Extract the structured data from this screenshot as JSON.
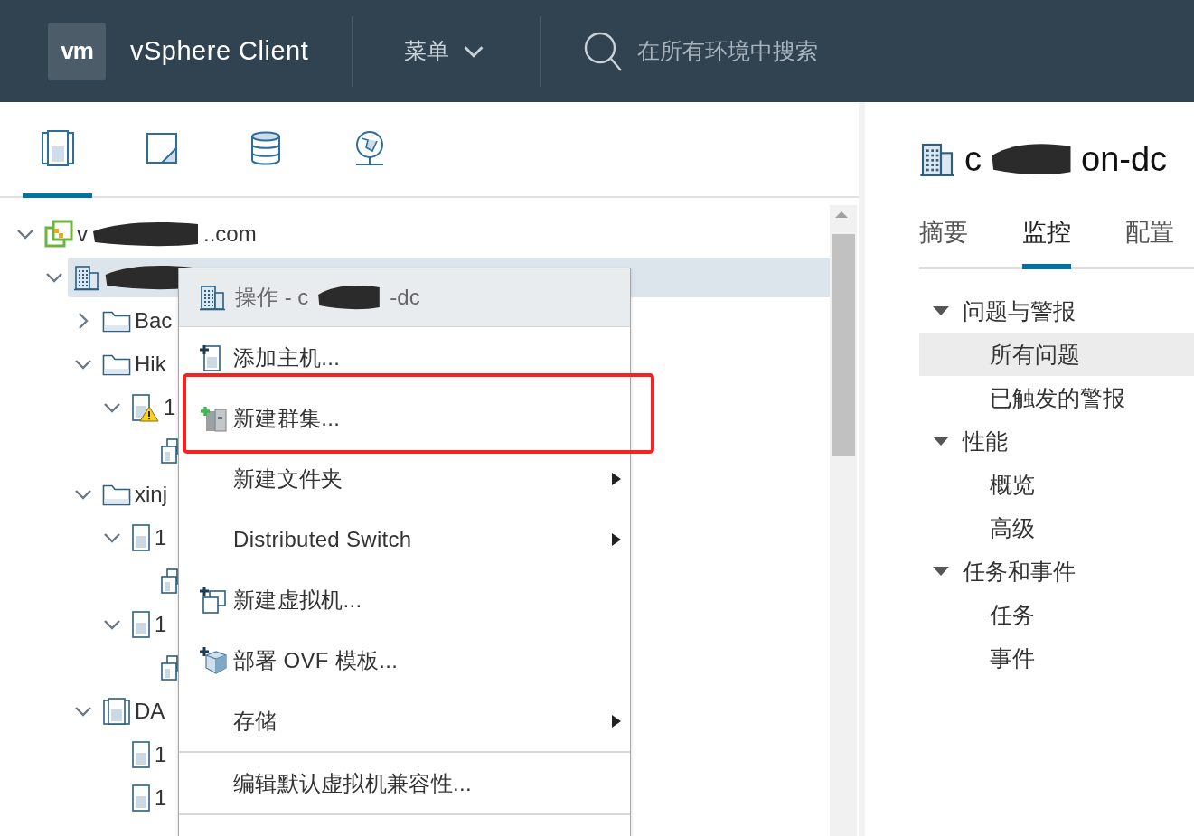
{
  "header": {
    "logo": "vm",
    "title": "vSphere Client",
    "menu": "菜单",
    "search": {
      "placeholder": "在所有环境中搜索"
    }
  },
  "view_tabs": [
    {
      "kind": "hosts",
      "selected": true
    },
    {
      "kind": "vms",
      "selected": false
    },
    {
      "kind": "storage",
      "selected": false
    },
    {
      "kind": "network",
      "selected": false
    }
  ],
  "tree": [
    {
      "kind": "vcenter",
      "label_start": "v",
      "label_end": "..com",
      "expanded": true,
      "selected": false,
      "children": [
        {
          "kind": "datacenter",
          "expanded": true,
          "selected": true,
          "children": [
            {
              "kind": "folder",
              "label": "Bac",
              "expanded": false,
              "selected": false
            },
            {
              "kind": "folder",
              "label": "Hik",
              "expanded": true,
              "selected": false,
              "children": [
                {
                  "kind": "host",
                  "label": "1",
                  "warning": true,
                  "expanded": true,
                  "selected": false,
                  "children": [
                    {
                      "kind": "vm",
                      "selected": false
                    }
                  ]
                }
              ]
            },
            {
              "kind": "folder",
              "label": "xinj",
              "expanded": true,
              "selected": false,
              "children": [
                {
                  "kind": "host",
                  "label": "1",
                  "warning": false,
                  "expanded": true,
                  "selected": false,
                  "children": [
                    {
                      "kind": "vm",
                      "selected": false
                    }
                  ]
                },
                {
                  "kind": "host",
                  "label": "1",
                  "warning": false,
                  "expanded": true,
                  "selected": false,
                  "children": [
                    {
                      "kind": "vm",
                      "selected": false
                    }
                  ]
                }
              ]
            },
            {
              "kind": "cluster",
              "label": "DA",
              "expanded": true,
              "selected": false,
              "children": [
                {
                  "kind": "host",
                  "label": "1",
                  "warning": false,
                  "selected": false
                },
                {
                  "kind": "host",
                  "label": "1",
                  "warning": false,
                  "selected": false
                }
              ]
            }
          ]
        }
      ]
    }
  ],
  "context_menu": {
    "title_start": "操作 - c",
    "title_end": "-dc",
    "items": [
      {
        "kind": "host",
        "label": "添加主机...",
        "submenu": false,
        "highlighted": false
      },
      {
        "kind": "cluster",
        "label": "新建群集...",
        "submenu": false,
        "highlighted": true
      },
      {
        "kind": "plain",
        "label": "新建文件夹",
        "submenu": true,
        "highlighted": false
      },
      {
        "kind": "plain",
        "label": "Distributed Switch",
        "submenu": true,
        "highlighted": false
      },
      {
        "kind": "vm",
        "label": "新建虚拟机...",
        "submenu": false,
        "highlighted": false
      },
      {
        "kind": "template",
        "label": "部署 OVF 模板...",
        "submenu": false,
        "highlighted": false
      },
      {
        "kind": "plain",
        "label": "存储",
        "submenu": true,
        "highlighted": false
      },
      {
        "kind": "divider"
      },
      {
        "kind": "plain",
        "label": "编辑默认虚拟机兼容性...",
        "submenu": false,
        "highlighted": false
      },
      {
        "kind": "divider"
      }
    ]
  },
  "detail": {
    "title_start": "c",
    "title_end": "on-dc",
    "tabs": [
      {
        "label": "摘要",
        "selected": false
      },
      {
        "label": "监控",
        "selected": true
      },
      {
        "label": "配置",
        "selected": false
      }
    ],
    "nav": [
      {
        "label": "问题与警报",
        "expanded": true,
        "children": [
          {
            "label": "所有问题",
            "selected": true
          },
          {
            "label": "已触发的警报",
            "selected": false
          }
        ]
      },
      {
        "label": "性能",
        "expanded": true,
        "children": [
          {
            "label": "概览",
            "selected": false
          },
          {
            "label": "高级",
            "selected": false
          }
        ]
      },
      {
        "label": "任务和事件",
        "expanded": true,
        "children": [
          {
            "label": "任务",
            "selected": false
          },
          {
            "label": "事件",
            "selected": false
          }
        ]
      }
    ]
  }
}
